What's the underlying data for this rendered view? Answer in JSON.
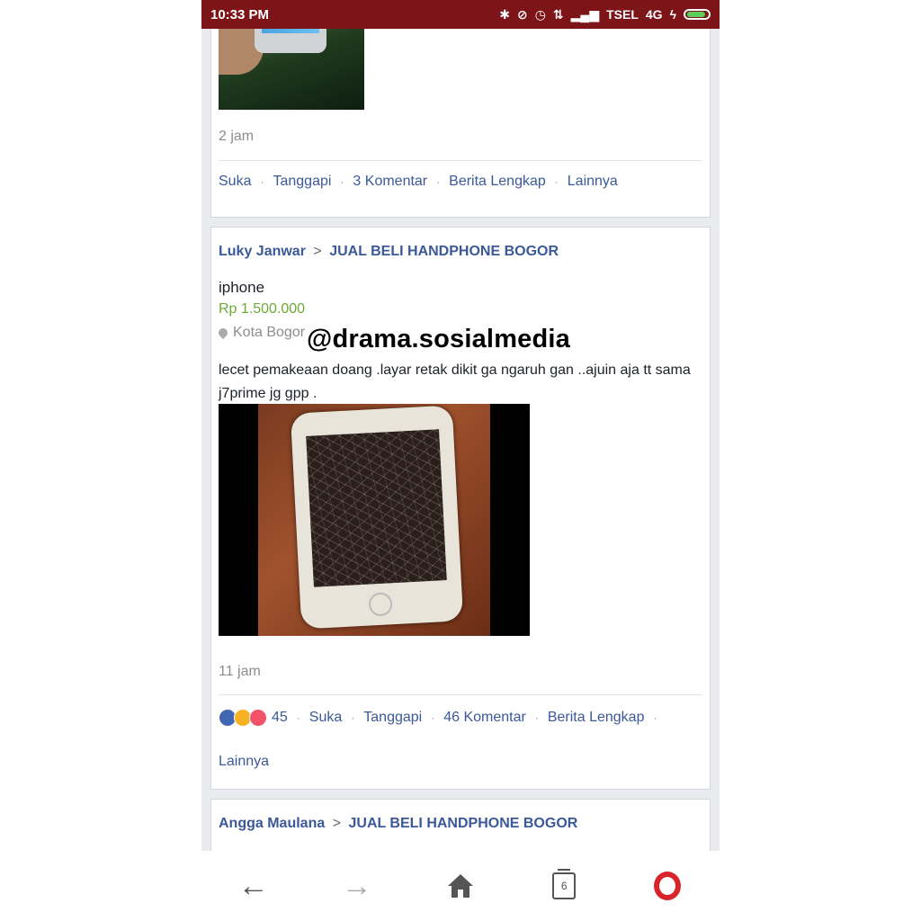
{
  "status_bar": {
    "time": "10:33 PM",
    "carrier": "TSEL",
    "network": "4G",
    "icons": [
      "bluetooth-icon",
      "mute-icon",
      "alarm-icon",
      "data-icon",
      "signal-icon",
      "charging-icon",
      "battery-icon"
    ]
  },
  "post1": {
    "time": "2 jam",
    "actions": {
      "like": "Suka",
      "reply": "Tanggapi",
      "comments": "3 Komentar",
      "full_story": "Berita Lengkap",
      "more": "Lainnya"
    }
  },
  "post2": {
    "author": "Luky Janwar",
    "separator": ">",
    "group": "JUAL BELI HANDPHONE BOGOR",
    "title": "iphone",
    "price": "Rp 1.500.000",
    "location": "Kota Bogor",
    "description": "lecet pemakeaan doang .layar retak dikit ga ngaruh gan ..ajuin aja tt sama j7prime jg gpp .",
    "time": "11 jam",
    "reaction_count": "45",
    "actions": {
      "like": "Suka",
      "reply": "Tanggapi",
      "comments": "46 Komentar",
      "full_story": "Berita Lengkap",
      "more": "Lainnya"
    }
  },
  "post3": {
    "author": "Angga Maulana",
    "separator": ">",
    "group": "JUAL BELI HANDPHONE BOGOR"
  },
  "watermark": "@drama.sosialmedia",
  "nav": {
    "tab_count": "6"
  },
  "colors": {
    "status_bar": "#7d1418",
    "link": "#3b5998",
    "price": "#6bab36",
    "opera": "#d8232a"
  }
}
